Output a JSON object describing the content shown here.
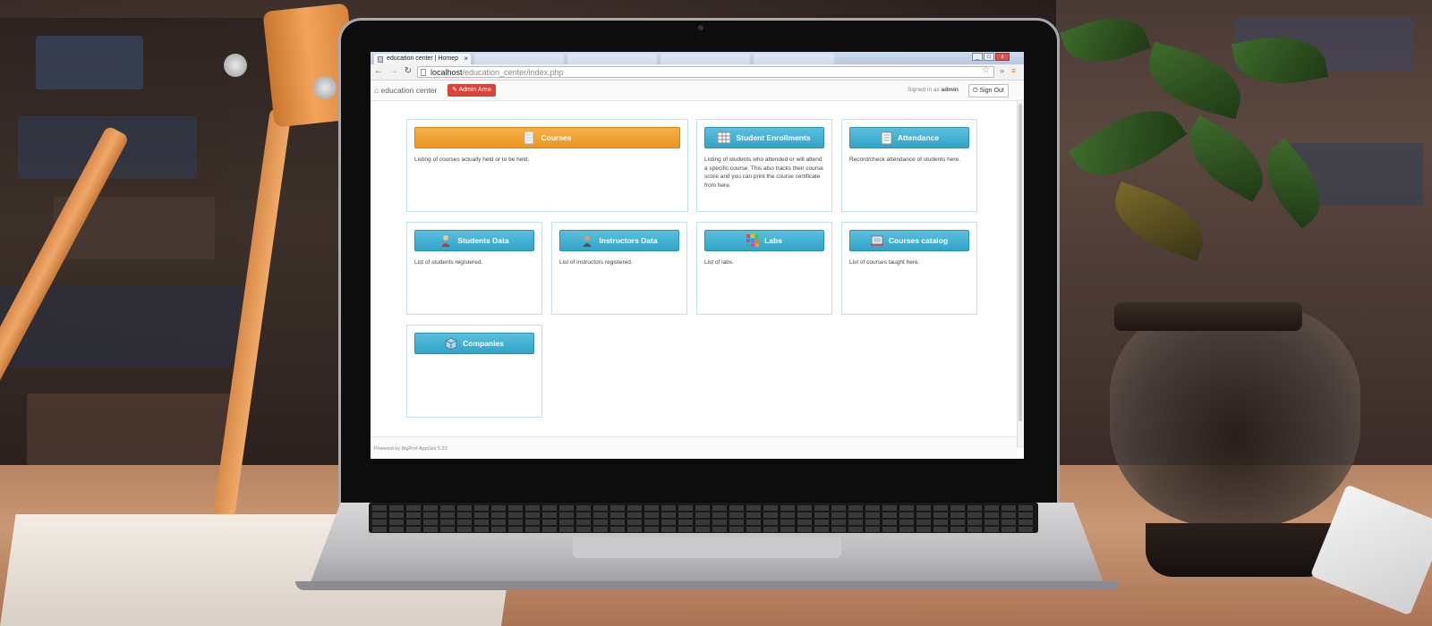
{
  "browser": {
    "tab_title": "education center | Homep",
    "tab_close": "×",
    "url_host": "localhost",
    "url_path": "/education_center/index.php",
    "nav_back": "←",
    "nav_forward": "→",
    "nav_reload": "↻",
    "star": "☆",
    "extensions": "»",
    "menu": "≡",
    "win_min": "_",
    "win_max": "□",
    "win_close": "x"
  },
  "app": {
    "brand": "education center",
    "home_icon": "home-icon",
    "admin_button": "Admin Area",
    "signed_in_prefix": "Signed in as",
    "signed_in_user": "admin",
    "sign_out": "Sign Out"
  },
  "cards": [
    {
      "label": "Courses",
      "description": "Listing of courses actually held or to be held.",
      "icon": "document-icon"
    },
    {
      "label": "Student Enrollments",
      "description": "Listing of students who attended or will attend a specific course. This also tracks their course score and you can print the course certificate from here.",
      "icon": "spreadsheet-icon"
    },
    {
      "label": "Attendance",
      "description": "Record/check attendance of students here.",
      "icon": "notepad-icon"
    },
    {
      "label": "Students Data",
      "description": "List of students registered.",
      "icon": "student-icon"
    },
    {
      "label": "Instructors Data",
      "description": "List of instructors registered.",
      "icon": "instructor-icon"
    },
    {
      "label": "Labs",
      "description": "List of labs.",
      "icon": "grid-icon"
    },
    {
      "label": "Courses catalog",
      "description": "List of courses taught here.",
      "icon": "catalog-icon"
    },
    {
      "label": "Companies",
      "description": "",
      "icon": "cube-icon"
    }
  ],
  "footer": {
    "text": "Powered by BigProf AppGini 5.23"
  },
  "colors": {
    "primary_button": "#5bc0de",
    "orange_button": "#ec971f",
    "admin_red": "#d9443a",
    "card_border": "#bfe0ee"
  }
}
